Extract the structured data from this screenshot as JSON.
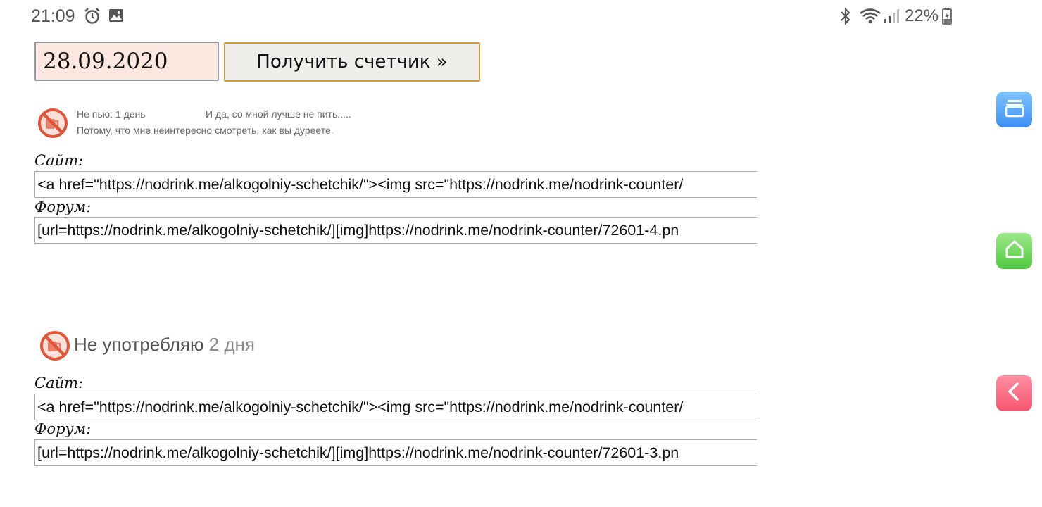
{
  "status_bar": {
    "time": "21:09",
    "left_icons": [
      "alarm-icon",
      "image-icon"
    ],
    "right_icons": [
      "bluetooth-icon",
      "wifi-icon",
      "signal-icon",
      "battery-icon"
    ],
    "battery": "22%"
  },
  "form": {
    "date_value": "28.09.2020",
    "submit_label": "Получить счетчик »"
  },
  "counter1": {
    "line1_left": "Не пью: 1 день",
    "line1_right": "И да, со мной лучше не пить.....",
    "line2": "Потому, что мне неинтересно смотреть, как вы дуреете.",
    "site_label": "Сайт:",
    "site_code": "<a href=\"https://nodrink.me/alkogolniy-schetchik/\"><img src=\"https://nodrink.me/nodrink-counter/",
    "forum_label": "Форум:",
    "forum_code": "[url=https://nodrink.me/alkogolniy-schetchik/][img]https://nodrink.me/nodrink-counter/72601-4.pn"
  },
  "counter2": {
    "text": "Не употребляю",
    "days": "2 дня",
    "site_label": "Сайт:",
    "site_code": "<a href=\"https://nodrink.me/alkogolniy-schetchik/\"><img src=\"https://nodrink.me/nodrink-counter/",
    "forum_label": "Форум:",
    "forum_code": "[url=https://nodrink.me/alkogolniy-schetchik/][img]https://nodrink.me/nodrink-counter/72601-3.pn"
  },
  "side_buttons": [
    {
      "icon": "stack-icon",
      "color": "#4a9af5"
    },
    {
      "icon": "home-icon",
      "color": "#5fd04a"
    },
    {
      "icon": "back-icon",
      "color": "#f66a80"
    }
  ],
  "colors": {
    "date_bg": "#fbe7e0",
    "button_border": "#c99a3b",
    "no_drink_red": "#e0563a"
  }
}
